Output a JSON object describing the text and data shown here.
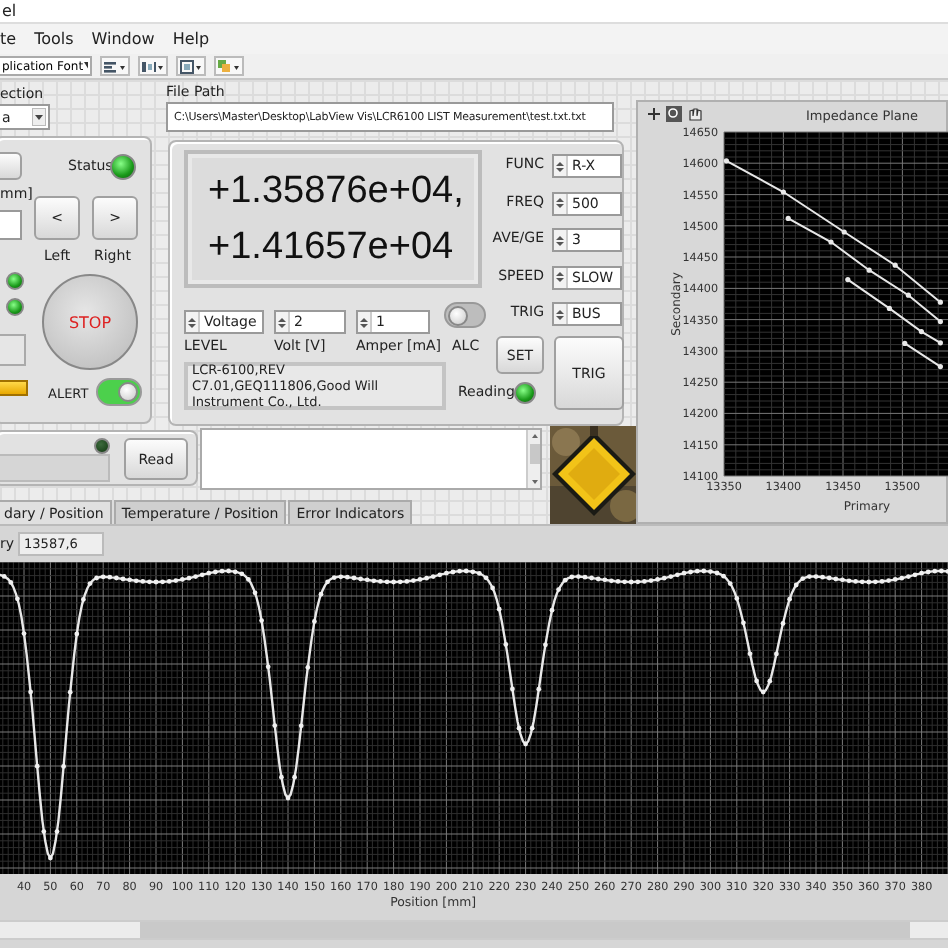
{
  "window": {
    "title": "el"
  },
  "menu": [
    {
      "label": "te"
    },
    {
      "label": "Tools"
    },
    {
      "label": "Window"
    },
    {
      "label": "Help"
    }
  ],
  "toolbar": {
    "font": "plication Font"
  },
  "connection": {
    "label": "ection",
    "value": "a"
  },
  "motion": {
    "status_label": "Status",
    "status_on": true,
    "unit_label": "mm]",
    "left_button": "<",
    "right_button": ">",
    "left_label": "Left",
    "right_label": "Right",
    "leds": [
      {
        "on": true
      },
      {
        "on": true
      }
    ],
    "stop_button": "STOP",
    "warning_on": true,
    "alert_label": "ALERT",
    "alert_on": true
  },
  "read": {
    "led_on": false,
    "button": "Read"
  },
  "file_path": {
    "label": "File Path",
    "value": "C:\\Users\\Master\\Desktop\\LabView Vis\\LCR6100 LIST Measurement\\test.txt.txt"
  },
  "display": {
    "lines": [
      "+1.35876e+04,",
      "+1.41657e+04"
    ]
  },
  "settings": [
    {
      "label": "FUNC",
      "value": "R-X"
    },
    {
      "label": "FREQ",
      "value": "500"
    },
    {
      "label": "AVE/GE",
      "value": "3"
    },
    {
      "label": "SPEED",
      "value": "SLOW"
    },
    {
      "label": "TRIG",
      "value": "BUS"
    }
  ],
  "source": [
    {
      "label": "LEVEL",
      "value": "Voltage"
    },
    {
      "label": "Volt [V]",
      "value": "2"
    },
    {
      "label": "Amper [mA]",
      "value": "1"
    }
  ],
  "alc": {
    "label": "ALC",
    "on": false
  },
  "id_string": "LCR-6100,REV C7.01,GEQ111806,Good Will Instrument Co., Ltd.",
  "set_button": "SET",
  "trig_button": "TRIG",
  "reading": {
    "label": "Reading",
    "on": true
  },
  "impedance_plane": {
    "chart_data": {
      "type": "line",
      "grid": true,
      "title": "Impedance Plane",
      "xlabel": "Primary",
      "ylabel": "Secondary",
      "xlim": [
        13350,
        13540
      ],
      "ylim": [
        14100,
        14650
      ],
      "xticks": [
        13350,
        13400,
        13450,
        13500
      ],
      "yticks": [
        14100,
        14150,
        14200,
        14250,
        14300,
        14350,
        14400,
        14450,
        14500,
        14550,
        14600,
        14650
      ],
      "series": [
        {
          "color": "#e8e8e8",
          "x": [
            13352,
            13400,
            13451,
            13494,
            13532
          ],
          "values": [
            14604,
            14554,
            14490,
            14437,
            14378
          ]
        },
        {
          "color": "#e8e8e8",
          "x": [
            13404,
            13440,
            13472,
            13505,
            13532
          ],
          "values": [
            14512,
            14474,
            14429,
            14389,
            14347
          ]
        },
        {
          "color": "#e8e8e8",
          "x": [
            13454,
            13489,
            13516,
            13532
          ],
          "values": [
            14414,
            14368,
            14331,
            14313
          ]
        },
        {
          "color": "#e8e8e8",
          "x": [
            13502,
            13532
          ],
          "values": [
            14312,
            14275
          ]
        }
      ]
    }
  },
  "tabs": [
    {
      "label": "dary / Position",
      "selected": true
    },
    {
      "label": "Temperature / Position",
      "selected": false
    },
    {
      "label": "Error Indicators",
      "selected": false
    }
  ],
  "position_view": {
    "readout_label": "ry",
    "readout_value": "13587,6",
    "xlabel": "Position [mm]",
    "xticks": [
      "40",
      "50",
      "60",
      "70",
      "80",
      "90",
      "100",
      "110",
      "120",
      "130",
      "140",
      "150",
      "160",
      "170",
      "180",
      "190",
      "200",
      "210",
      "220",
      "230",
      "240",
      "250",
      "260",
      "270",
      "280",
      "290",
      "300",
      "310",
      "320",
      "330",
      "340",
      "350",
      "360",
      "370",
      "380"
    ]
  }
}
